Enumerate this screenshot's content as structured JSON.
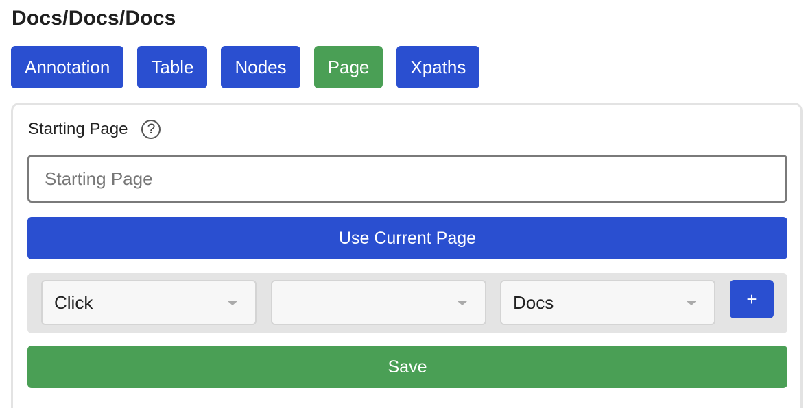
{
  "header": {
    "title": "Docs/Docs/Docs"
  },
  "tabs": [
    {
      "label": "Annotation",
      "active": false
    },
    {
      "label": "Table",
      "active": false
    },
    {
      "label": "Nodes",
      "active": false
    },
    {
      "label": "Page",
      "active": true
    },
    {
      "label": "Xpaths",
      "active": false
    }
  ],
  "starting_page": {
    "label": "Starting Page",
    "help_icon": "?",
    "input_value": "",
    "placeholder": "Starting Page"
  },
  "use_current_page_label": "Use Current Page",
  "action": {
    "selects": [
      {
        "value": "Click"
      },
      {
        "value": ""
      },
      {
        "value": "Docs"
      }
    ],
    "add_label": "+"
  },
  "save_label": "Save",
  "colors": {
    "primary": "#2a4fd0",
    "success": "#4a9f55"
  },
  "icons": {
    "help": "help-icon",
    "dropdown": "chevron-down-icon"
  }
}
